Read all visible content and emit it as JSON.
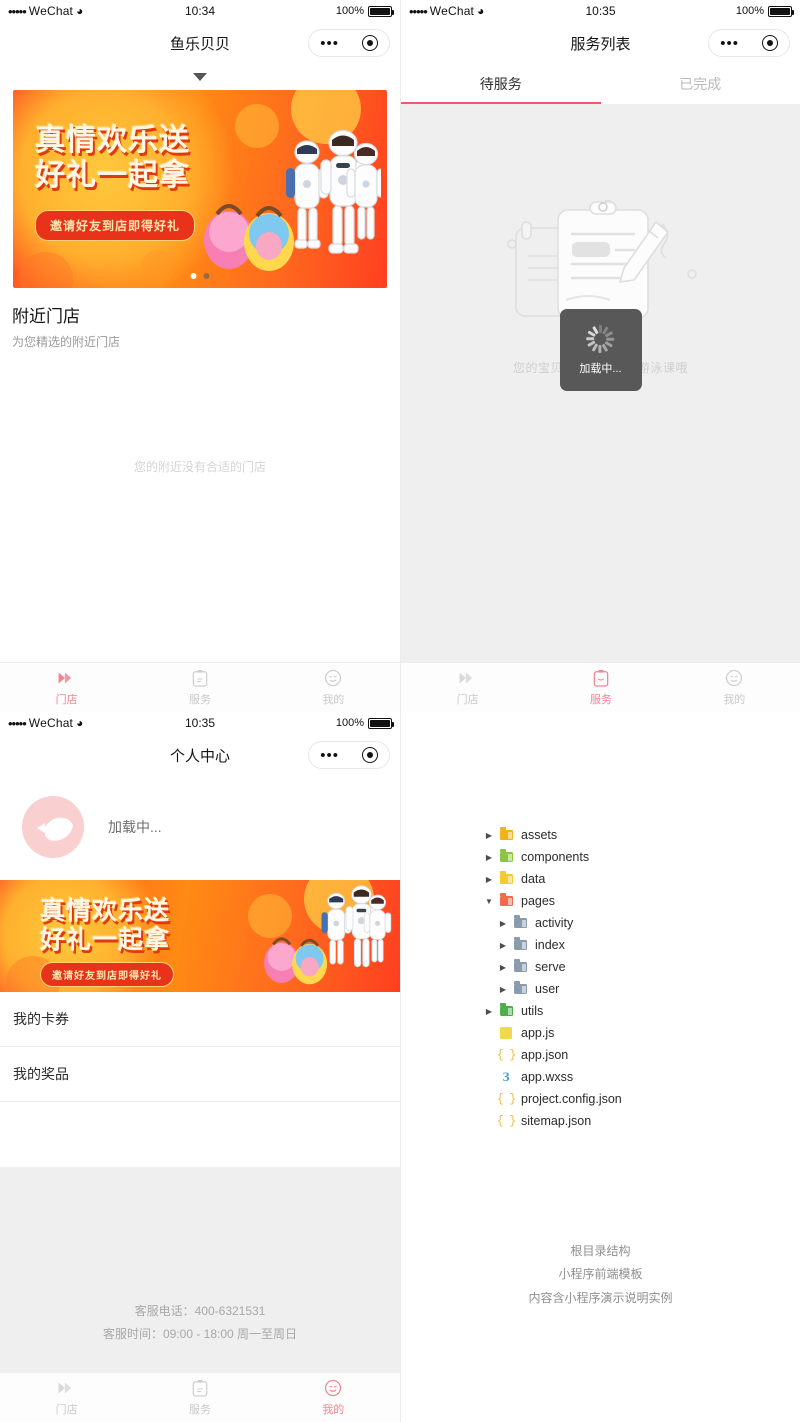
{
  "status_bar": {
    "carrier": "WeChat",
    "dots": "•••••",
    "battery_pct": "100%",
    "time_1": "10:34",
    "time_2": "10:35",
    "time_3": "10:35"
  },
  "capsule": {
    "menu_icon": "more-dots-icon",
    "target_icon": "close-target-icon"
  },
  "panel_store": {
    "nav_title": "鱼乐贝贝",
    "pull_arrow_icon": "chevron-down-icon",
    "banner": {
      "line1": "真情欢乐送",
      "line2": "好礼一起拿",
      "button": "邀请好友到店即得好礼",
      "dots": [
        "inactive",
        "active"
      ]
    },
    "section": {
      "title": "附近门店",
      "subtitle": "为您精选的附近门店",
      "empty": "您的附近没有合适的门店"
    },
    "tabs": [
      {
        "label": "门店",
        "icon": "store-icon",
        "active": true
      },
      {
        "label": "服务",
        "icon": "clipboard-icon",
        "active": false
      },
      {
        "label": "我的",
        "icon": "smiley-icon",
        "active": false
      }
    ]
  },
  "panel_service": {
    "nav_title": "服务列表",
    "segments": [
      {
        "label": "待服务",
        "active": true
      },
      {
        "label": "已完成",
        "active": false
      }
    ],
    "empty_message": "您的宝贝还没有购买的游泳课哦",
    "illustration_icon": "clipboard-pen-illustration",
    "toast": {
      "label": "加载中...",
      "icon": "spinner-icon"
    },
    "tabs": [
      {
        "label": "门店",
        "icon": "store-icon",
        "active": false
      },
      {
        "label": "服务",
        "icon": "clipboard-icon",
        "active": true
      },
      {
        "label": "我的",
        "icon": "smiley-icon",
        "active": false
      }
    ]
  },
  "panel_profile": {
    "nav_title": "个人中心",
    "avatar_icon": "fish-avatar-icon",
    "loading_text": "加载中...",
    "banner": {
      "line1": "真情欢乐送",
      "line2": "好礼一起拿",
      "button": "邀请好友到店即得好礼"
    },
    "menu": [
      {
        "label": "我的卡券"
      },
      {
        "label": "我的奖品"
      }
    ],
    "footer": {
      "phone": "客服电话：400-6321531",
      "hours": "客服时间：09:00 - 18:00 周一至周日"
    },
    "tabs": [
      {
        "label": "门店",
        "icon": "store-icon",
        "active": false
      },
      {
        "label": "服务",
        "icon": "clipboard-icon",
        "active": false
      },
      {
        "label": "我的",
        "icon": "smiley-icon",
        "active": true
      }
    ]
  },
  "panel_tree": {
    "nodes": [
      {
        "name": "assets",
        "type": "folder",
        "color": "#f2b21c",
        "level": 1,
        "caret": "collapsed"
      },
      {
        "name": "components",
        "type": "folder",
        "color": "#8cc63e",
        "level": 1,
        "caret": "collapsed"
      },
      {
        "name": "data",
        "type": "folder",
        "color": "#f5ca2e",
        "level": 1,
        "caret": "collapsed"
      },
      {
        "name": "pages",
        "type": "folder",
        "color": "#ef6b4a",
        "level": 1,
        "caret": "expanded"
      },
      {
        "name": "activity",
        "type": "folder",
        "color": "#8a9bad",
        "level": 2,
        "caret": "collapsed"
      },
      {
        "name": "index",
        "type": "folder",
        "color": "#8a9bad",
        "level": 2,
        "caret": "collapsed"
      },
      {
        "name": "serve",
        "type": "folder",
        "color": "#8a9bad",
        "level": 2,
        "caret": "collapsed"
      },
      {
        "name": "user",
        "type": "folder",
        "color": "#8a9bad",
        "level": 2,
        "caret": "collapsed"
      },
      {
        "name": "utils",
        "type": "folder",
        "color": "#4cae4c",
        "level": 1,
        "caret": "collapsed"
      },
      {
        "name": "app.js",
        "type": "js",
        "color": "#f0d94a",
        "level": 1,
        "caret": "none"
      },
      {
        "name": "app.json",
        "type": "json",
        "color": "#e8c24a",
        "level": 1,
        "caret": "none"
      },
      {
        "name": "app.wxss",
        "type": "wxss",
        "color": "#3f9ed6",
        "level": 1,
        "caret": "none"
      },
      {
        "name": "project.config.json",
        "type": "json",
        "color": "#e8c24a",
        "level": 1,
        "caret": "none"
      },
      {
        "name": "sitemap.json",
        "type": "json",
        "color": "#e8c24a",
        "level": 1,
        "caret": "none"
      }
    ],
    "caption": [
      "根目录结构",
      "小程序前端模板",
      "内容含小程序演示说明实例"
    ]
  },
  "colors": {
    "accent_pink": "#f5868f",
    "tab_underline": "#f2576e",
    "banner_orange": "#ff6a1e",
    "empty_grey": "#cfcfcf"
  }
}
